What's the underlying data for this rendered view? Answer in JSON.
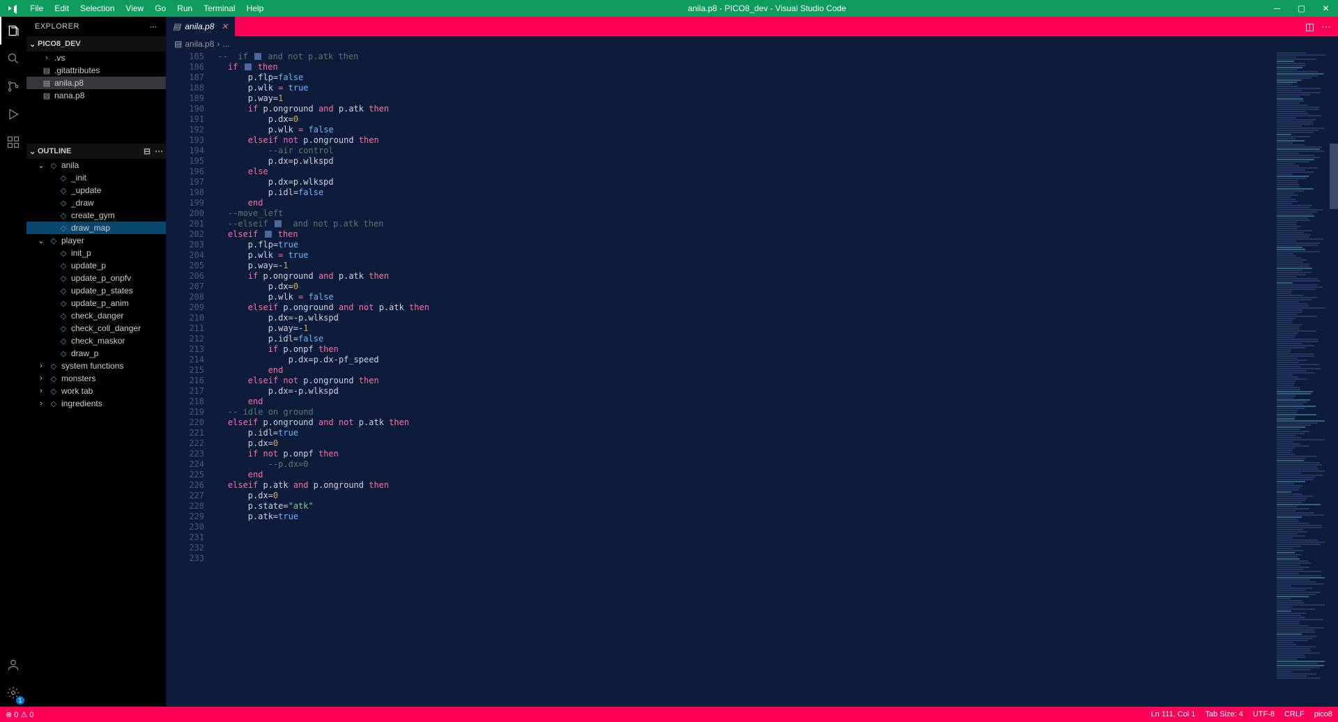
{
  "title": "anila.p8 - PICO8_dev - Visual Studio Code",
  "menu": [
    "File",
    "Edit",
    "Selection",
    "View",
    "Go",
    "Run",
    "Terminal",
    "Help"
  ],
  "explorer": {
    "label": "EXPLORER",
    "folder": "PICO8_DEV",
    "files": [
      {
        "label": ".vs",
        "type": "folder",
        "indent": 1
      },
      {
        "label": ".gitattributes",
        "type": "file",
        "indent": 1
      },
      {
        "label": "anila.p8",
        "type": "file",
        "indent": 1,
        "highlight": true
      },
      {
        "label": "nana.p8",
        "type": "file",
        "indent": 1
      }
    ]
  },
  "outline": {
    "label": "OUTLINE",
    "items": [
      {
        "label": "anila",
        "indent": 0,
        "type": "ns",
        "expanded": true
      },
      {
        "label": "_init",
        "indent": 1,
        "type": "fn"
      },
      {
        "label": "_update",
        "indent": 1,
        "type": "fn"
      },
      {
        "label": "_draw",
        "indent": 1,
        "type": "fn"
      },
      {
        "label": "create_gym",
        "indent": 1,
        "type": "fn"
      },
      {
        "label": "draw_map",
        "indent": 1,
        "type": "fn",
        "selected": true
      },
      {
        "label": "player",
        "indent": 0,
        "type": "ns",
        "expanded": true
      },
      {
        "label": "init_p",
        "indent": 1,
        "type": "fn"
      },
      {
        "label": "update_p",
        "indent": 1,
        "type": "fn"
      },
      {
        "label": "update_p_onpfv",
        "indent": 1,
        "type": "fn"
      },
      {
        "label": "update_p_states",
        "indent": 1,
        "type": "fn"
      },
      {
        "label": "update_p_anim",
        "indent": 1,
        "type": "fn"
      },
      {
        "label": "check_danger",
        "indent": 1,
        "type": "fn"
      },
      {
        "label": "check_coll_danger",
        "indent": 1,
        "type": "fn"
      },
      {
        "label": "check_maskor",
        "indent": 1,
        "type": "fn"
      },
      {
        "label": "draw_p",
        "indent": 1,
        "type": "fn"
      },
      {
        "label": "system functions",
        "indent": 0,
        "type": "ns",
        "expanded": false
      },
      {
        "label": "monsters",
        "indent": 0,
        "type": "ns",
        "expanded": false
      },
      {
        "label": "work tab",
        "indent": 0,
        "type": "ns",
        "expanded": false
      },
      {
        "label": "ingredients",
        "indent": 0,
        "type": "ns",
        "expanded": false
      }
    ]
  },
  "tab": {
    "label": "anila.p8"
  },
  "breadcrumb": {
    "file": "anila.p8",
    "more": "..."
  },
  "line_start": 185,
  "line_end": 233,
  "code": [
    [
      [
        "  ",
        "tok-ident"
      ],
      [
        "--  if ",
        "tok-comment"
      ],
      [
        "[btn]",
        "btn"
      ],
      [
        " and not p.atk then",
        "tok-comment"
      ]
    ],
    [
      [
        "    ",
        "tok-ident"
      ],
      [
        "if",
        "tok-keyword"
      ],
      [
        " ",
        "tok-ident"
      ],
      [
        "[btn]",
        "btn"
      ],
      [
        " ",
        "tok-ident"
      ],
      [
        "then",
        "tok-keyword"
      ]
    ],
    [
      [
        "        p.flp=",
        "tok-ident"
      ],
      [
        "false",
        "tok-bool"
      ]
    ],
    [
      [
        "        p.wlk ",
        "tok-ident"
      ],
      [
        "=",
        "tok-op"
      ],
      [
        " ",
        "tok-ident"
      ],
      [
        "true",
        "tok-bool"
      ]
    ],
    [
      [
        "        p.way=",
        "tok-ident"
      ],
      [
        "1",
        "tok-num"
      ]
    ],
    [
      [
        "        ",
        "tok-ident"
      ],
      [
        "if",
        "tok-keyword"
      ],
      [
        " p.onground ",
        "tok-ident"
      ],
      [
        "and",
        "tok-keyword"
      ],
      [
        " p.atk ",
        "tok-ident"
      ],
      [
        "then",
        "tok-keyword"
      ]
    ],
    [
      [
        "            p.dx=",
        "tok-ident"
      ],
      [
        "0",
        "tok-num"
      ]
    ],
    [
      [
        "            p.wlk ",
        "tok-ident"
      ],
      [
        "=",
        "tok-op"
      ],
      [
        " ",
        "tok-ident"
      ],
      [
        "false",
        "tok-bool"
      ]
    ],
    [
      [
        "        ",
        "tok-ident"
      ],
      [
        "elseif",
        "tok-keyword"
      ],
      [
        " ",
        "tok-ident"
      ],
      [
        "not",
        "tok-keyword"
      ],
      [
        " p.onground ",
        "tok-ident"
      ],
      [
        "then",
        "tok-keyword"
      ]
    ],
    [
      [
        "            ",
        "tok-ident"
      ],
      [
        "--air control",
        "tok-comment"
      ]
    ],
    [
      [
        "            p.dx=p.wlkspd",
        "tok-ident"
      ]
    ],
    [
      [
        "        ",
        "tok-ident"
      ],
      [
        "else",
        "tok-keyword"
      ]
    ],
    [
      [
        "            p.dx=p.wlkspd",
        "tok-ident"
      ]
    ],
    [
      [
        "            p.idl=",
        "tok-ident"
      ],
      [
        "false",
        "tok-bool"
      ]
    ],
    [
      [
        "        ",
        "tok-ident"
      ],
      [
        "end",
        "tok-keyword"
      ]
    ],
    [
      [
        "",
        "tok-ident"
      ]
    ],
    [
      [
        "",
        "tok-ident"
      ]
    ],
    [
      [
        "    ",
        "tok-ident"
      ],
      [
        "--move_left",
        "tok-comment"
      ]
    ],
    [
      [
        "    ",
        "tok-ident"
      ],
      [
        "--elseif ",
        "tok-comment"
      ],
      [
        "[btn]",
        "btn"
      ],
      [
        "  and not p.atk then",
        "tok-comment"
      ]
    ],
    [
      [
        "    ",
        "tok-ident"
      ],
      [
        "elseif",
        "tok-keyword"
      ],
      [
        " ",
        "tok-ident"
      ],
      [
        "[btn]",
        "btn"
      ],
      [
        " ",
        "tok-ident"
      ],
      [
        "then",
        "tok-keyword"
      ]
    ],
    [
      [
        "        p.flp=",
        "tok-ident"
      ],
      [
        "true",
        "tok-bool"
      ]
    ],
    [
      [
        "        p.wlk ",
        "tok-ident"
      ],
      [
        "=",
        "tok-op"
      ],
      [
        " ",
        "tok-ident"
      ],
      [
        "true",
        "tok-bool"
      ]
    ],
    [
      [
        "        p.way=-",
        "tok-ident"
      ],
      [
        "1",
        "tok-num"
      ]
    ],
    [
      [
        "        ",
        "tok-ident"
      ],
      [
        "if",
        "tok-keyword"
      ],
      [
        " p.onground ",
        "tok-ident"
      ],
      [
        "and",
        "tok-keyword"
      ],
      [
        " p.atk ",
        "tok-ident"
      ],
      [
        "then",
        "tok-keyword"
      ]
    ],
    [
      [
        "            p.dx=",
        "tok-ident"
      ],
      [
        "0",
        "tok-num"
      ]
    ],
    [
      [
        "            p.wlk ",
        "tok-ident"
      ],
      [
        "=",
        "tok-op"
      ],
      [
        " ",
        "tok-ident"
      ],
      [
        "false",
        "tok-bool"
      ]
    ],
    [
      [
        "        ",
        "tok-ident"
      ],
      [
        "elseif",
        "tok-keyword"
      ],
      [
        " p.onground ",
        "tok-ident"
      ],
      [
        "and",
        "tok-keyword"
      ],
      [
        " ",
        "tok-ident"
      ],
      [
        "not",
        "tok-keyword"
      ],
      [
        " p.atk ",
        "tok-ident"
      ],
      [
        "then",
        "tok-keyword"
      ]
    ],
    [
      [
        "            p.dx=-p.wlkspd",
        "tok-ident"
      ]
    ],
    [
      [
        "            p.way=-",
        "tok-ident"
      ],
      [
        "1",
        "tok-num"
      ]
    ],
    [
      [
        "            p.idl=",
        "tok-ident"
      ],
      [
        "false",
        "tok-bool"
      ]
    ],
    [
      [
        "            ",
        "tok-ident"
      ],
      [
        "if",
        "tok-keyword"
      ],
      [
        " p.onpf ",
        "tok-ident"
      ],
      [
        "then",
        "tok-keyword"
      ]
    ],
    [
      [
        "                p.dx=p.dx-pf_speed",
        "tok-ident"
      ]
    ],
    [
      [
        "            ",
        "tok-ident"
      ],
      [
        "end",
        "tok-keyword"
      ]
    ],
    [
      [
        "        ",
        "tok-ident"
      ],
      [
        "elseif",
        "tok-keyword"
      ],
      [
        " ",
        "tok-ident"
      ],
      [
        "not",
        "tok-keyword"
      ],
      [
        " p.onground ",
        "tok-ident"
      ],
      [
        "then",
        "tok-keyword"
      ]
    ],
    [
      [
        "            p.dx=-p.wlkspd",
        "tok-ident"
      ]
    ],
    [
      [
        "        ",
        "tok-ident"
      ],
      [
        "end",
        "tok-keyword"
      ]
    ],
    [
      [
        "",
        "tok-ident"
      ]
    ],
    [
      [
        "    ",
        "tok-ident"
      ],
      [
        "-- idle on ground",
        "tok-comment"
      ]
    ],
    [
      [
        "    ",
        "tok-ident"
      ],
      [
        "elseif",
        "tok-keyword"
      ],
      [
        " p.onground ",
        "tok-ident"
      ],
      [
        "and",
        "tok-keyword"
      ],
      [
        " ",
        "tok-ident"
      ],
      [
        "not",
        "tok-keyword"
      ],
      [
        " p.atk ",
        "tok-ident"
      ],
      [
        "then",
        "tok-keyword"
      ]
    ],
    [
      [
        "        p.idl=",
        "tok-ident"
      ],
      [
        "true",
        "tok-bool"
      ]
    ],
    [
      [
        "        p.dx=",
        "tok-ident"
      ],
      [
        "0",
        "tok-num"
      ]
    ],
    [
      [
        "        ",
        "tok-ident"
      ],
      [
        "if",
        "tok-keyword"
      ],
      [
        " ",
        "tok-ident"
      ],
      [
        "not",
        "tok-keyword"
      ],
      [
        " p.onpf ",
        "tok-ident"
      ],
      [
        "then",
        "tok-keyword"
      ]
    ],
    [
      [
        "            ",
        "tok-ident"
      ],
      [
        "--p.dx=0",
        "tok-comment"
      ]
    ],
    [
      [
        "        ",
        "tok-ident"
      ],
      [
        "end",
        "tok-keyword"
      ]
    ],
    [
      [
        "",
        "tok-ident"
      ]
    ],
    [
      [
        "    ",
        "tok-ident"
      ],
      [
        "elseif",
        "tok-keyword"
      ],
      [
        " p.atk ",
        "tok-ident"
      ],
      [
        "and",
        "tok-keyword"
      ],
      [
        " p.onground ",
        "tok-ident"
      ],
      [
        "then",
        "tok-keyword"
      ]
    ],
    [
      [
        "        p.dx=",
        "tok-ident"
      ],
      [
        "0",
        "tok-num"
      ]
    ],
    [
      [
        "        p.state=",
        "tok-ident"
      ],
      [
        "\"atk\"",
        "tok-string"
      ]
    ],
    [
      [
        "        p.atk=",
        "tok-ident"
      ],
      [
        "true",
        "tok-bool"
      ]
    ]
  ],
  "status": {
    "left": [
      "⊗ 0 ⚠ 0"
    ],
    "right": [
      "Ln 111, Col 1",
      "Tab Size: 4",
      "UTF-8",
      "CRLF",
      "pico8"
    ]
  }
}
